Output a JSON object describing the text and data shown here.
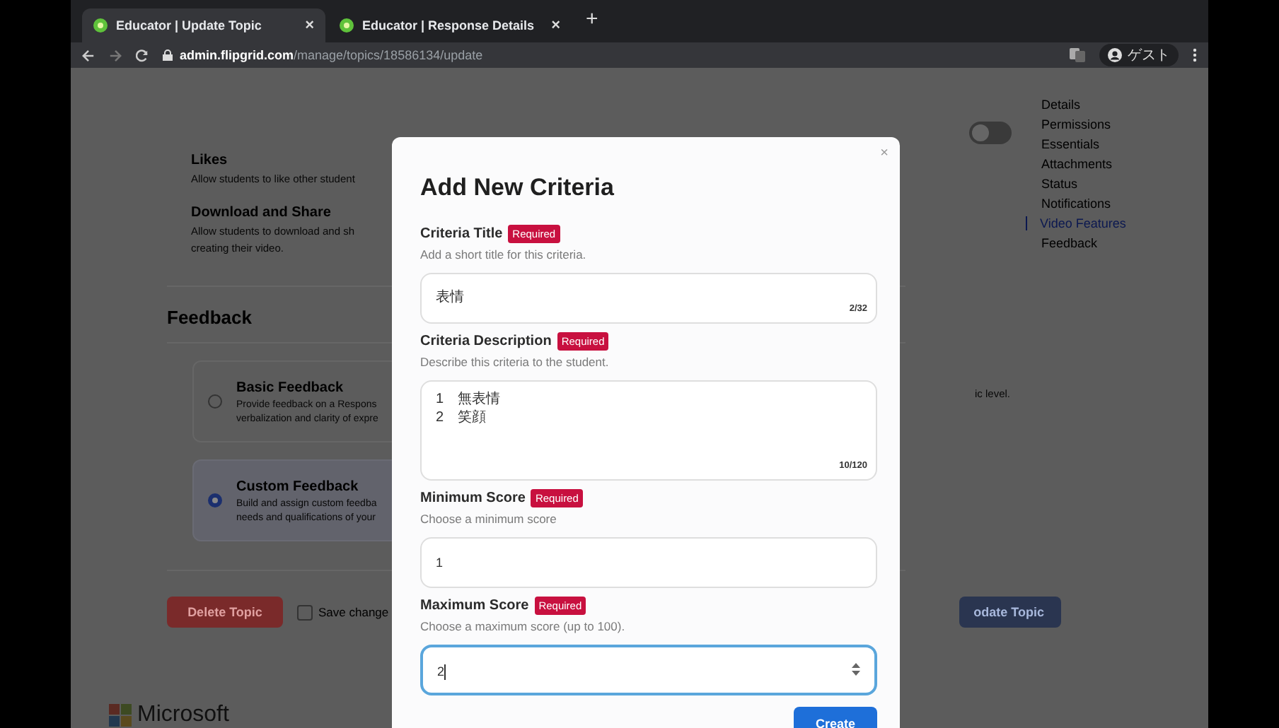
{
  "browser": {
    "tabs": [
      {
        "title": "Educator | Update Topic",
        "close": "×",
        "selected": true
      },
      {
        "title": "Educator | Response Details",
        "close": "×",
        "selected": false
      }
    ],
    "new_tab": "+",
    "url": {
      "host": "admin.flipgrid.com",
      "path": "/manage/topics/18586134/update"
    },
    "profile": "ゲスト"
  },
  "page": {
    "settings": [
      {
        "title": "Likes",
        "description": [
          "Allow students to like other student"
        ]
      },
      {
        "title": "Download and Share",
        "description": [
          "Allow students to download and sh",
          "creating their video."
        ]
      }
    ],
    "toggle": {
      "on": false
    },
    "side_text": "ic level.",
    "feedback": {
      "heading": "Feedback",
      "options": [
        {
          "title": "Basic Feedback",
          "description": [
            "Provide feedback on a Respons",
            "verbalization and clarity of expre"
          ],
          "selected": false
        },
        {
          "title": "Custom Feedback",
          "description": [
            "Build and assign custom feedba",
            "needs and qualifications of your"
          ],
          "selected": true
        }
      ]
    },
    "delete_button": "Delete Topic",
    "save_checkbox": {
      "label": "Save change",
      "checked": false
    },
    "update_button": "odate Topic",
    "nav": [
      {
        "label": "Details",
        "selected": false
      },
      {
        "label": "Permissions",
        "selected": false
      },
      {
        "label": "Essentials",
        "selected": false
      },
      {
        "label": "Attachments",
        "selected": false
      },
      {
        "label": "Status",
        "selected": false
      },
      {
        "label": "Notifications",
        "selected": false
      },
      {
        "label": "Video Features",
        "selected": true
      },
      {
        "label": "Feedback",
        "selected": false
      }
    ],
    "footer_logo": "Microsoft"
  },
  "modal": {
    "close": "×",
    "title": "Add New Criteria",
    "fields": [
      {
        "kind": "text",
        "label": "Criteria Title",
        "badge": "Required",
        "hint": "Add a short title for this criteria.",
        "value": "表情",
        "counter": "2/32",
        "focused": false
      },
      {
        "kind": "textarea",
        "label": "Criteria Description",
        "badge": "Required",
        "hint": "Describe this criteria to the student.",
        "value": "1　無表情\n2　笑顔",
        "counter": "10/120",
        "focused": false
      },
      {
        "kind": "number",
        "label": "Minimum Score",
        "badge": "Required",
        "hint": "Choose a minimum score",
        "value": "1",
        "focused": false
      },
      {
        "kind": "number",
        "label": "Maximum Score",
        "badge": "Required",
        "hint": "Choose a maximum score (up to 100).",
        "value": "2",
        "focused": true
      }
    ],
    "submit": "Create"
  }
}
